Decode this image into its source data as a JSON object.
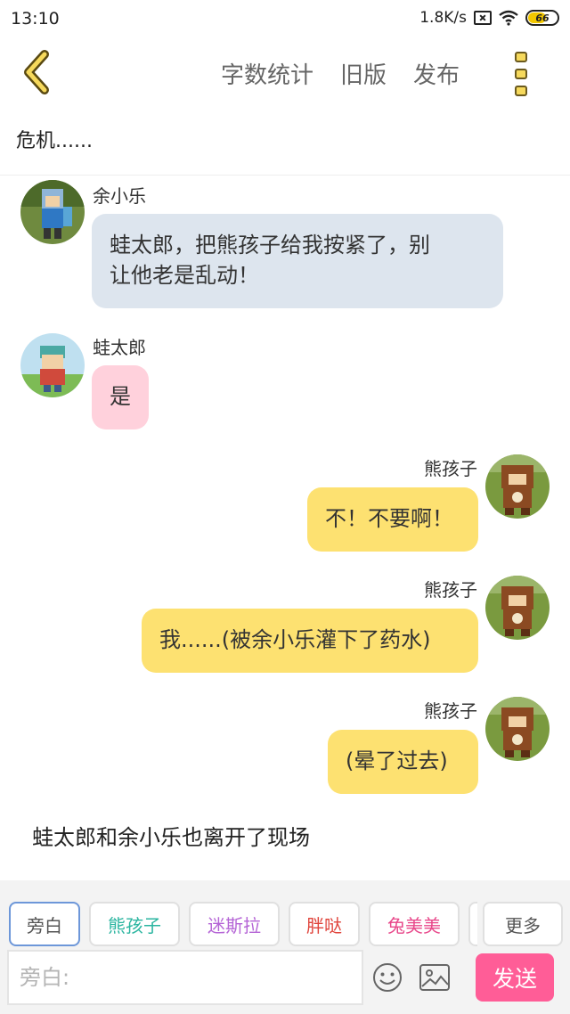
{
  "status_bar": {
    "time": "13:10",
    "speed": "1.8K/s",
    "battery": "66"
  },
  "header": {
    "actions": [
      "字数统计",
      "旧版",
      "发布"
    ]
  },
  "story_title": "危机......",
  "messages": [
    {
      "speaker": "余小乐",
      "text_lines": [
        "蛙太郎，把熊孩子给我按紧了，别",
        "让他老是乱动！"
      ],
      "bubble_color": "#dde5ee"
    },
    {
      "speaker": "蛙太郎",
      "text_lines": [
        "是"
      ],
      "bubble_color": "#ffd1dc"
    },
    {
      "speaker": "熊孩子",
      "text_lines": [
        "不！不要啊！"
      ],
      "bubble_color": "#fde171"
    },
    {
      "speaker": "熊孩子",
      "text_lines": [
        "我......(被余小乐灌下了药水)"
      ],
      "bubble_color": "#fde171"
    },
    {
      "speaker": "熊孩子",
      "text_lines": [
        "(晕了过去)"
      ],
      "bubble_color": "#fde171"
    }
  ],
  "narration": "蛙太郎和余小乐也离开了现场",
  "roles": [
    {
      "label": "旁白",
      "color": "#555555"
    },
    {
      "label": "熊孩子",
      "color": "#2bb5a0"
    },
    {
      "label": "迷斯拉",
      "color": "#b565d6"
    },
    {
      "label": "胖哒",
      "color": "#e0443b"
    },
    {
      "label": "兔美美",
      "color": "#e8478a"
    }
  ],
  "more_label": "更多",
  "input": {
    "placeholder": "旁白:"
  },
  "send_label": "发送",
  "colors": {
    "accent": "#ff5d97",
    "back_icon": "#f6d95c"
  }
}
